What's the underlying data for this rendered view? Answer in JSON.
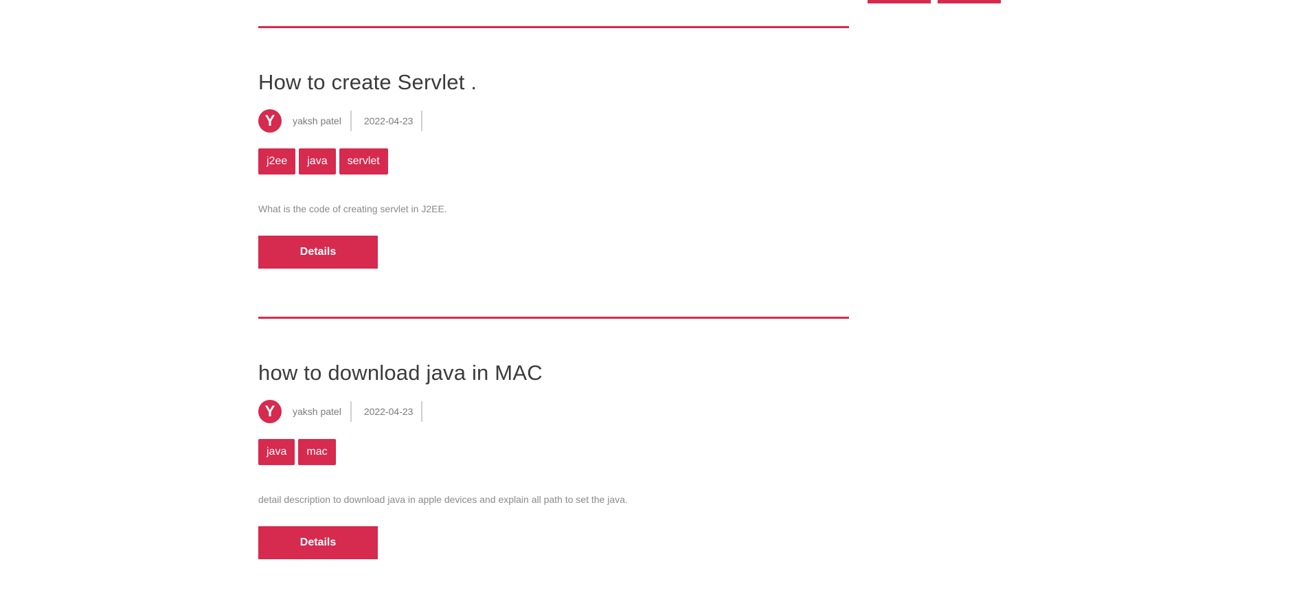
{
  "colors": {
    "accent": "#d62a4e",
    "title_text": "#3b3b3b",
    "meta_text": "#7a7a7a",
    "description_text": "#8a8a8a"
  },
  "posts": [
    {
      "title": "How to create Servlet .",
      "avatar_letter": "Y",
      "author": "yaksh patel",
      "date": "2022-04-23",
      "tags": [
        "j2ee",
        "java",
        "servlet"
      ],
      "description": "What is the code of creating servlet in J2EE.",
      "details_label": "Details"
    },
    {
      "title": "how to download java in MAC",
      "avatar_letter": "Y",
      "author": "yaksh patel",
      "date": "2022-04-23",
      "tags": [
        "java",
        "mac"
      ],
      "description": "detail description to download java in apple devices and explain all path to set the java.",
      "details_label": "Details"
    }
  ]
}
